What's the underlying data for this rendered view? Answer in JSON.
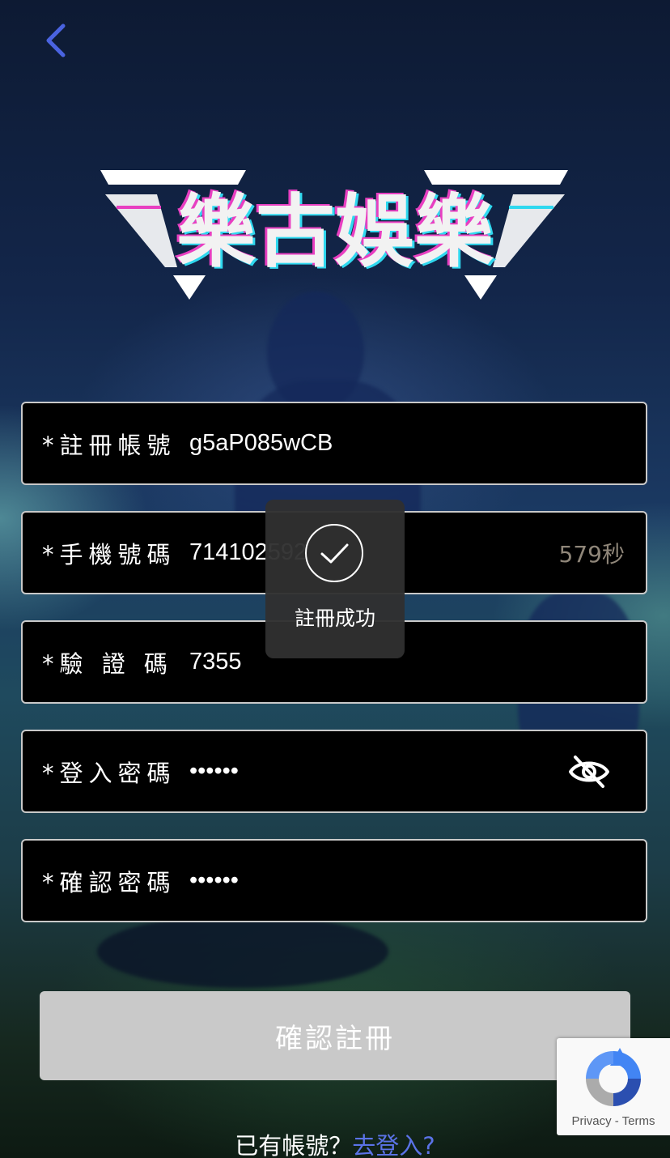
{
  "header": {
    "back_icon": "chevron-left-icon",
    "logo_text": "樂古娛樂"
  },
  "form": {
    "fields": [
      {
        "label": "*註冊帳號",
        "value": "g5aP085wCB"
      },
      {
        "label": "*手機號碼",
        "value": "714102592",
        "countdown": "579秒"
      },
      {
        "label": "*驗 證 碼",
        "value": "7355"
      },
      {
        "label": "*登入密碼",
        "value": "••••••",
        "toggle_icon": "eye-off-icon"
      },
      {
        "label": "*確認密碼",
        "value": "••••••"
      }
    ],
    "submit_label": "確認註冊"
  },
  "toast": {
    "icon": "check-circle-icon",
    "message": "註冊成功"
  },
  "footer": {
    "prompt": "已有帳號？",
    "login_link": "去登入?"
  },
  "recaptcha": {
    "privacy": "Privacy",
    "separator": " - ",
    "terms": "Terms"
  },
  "colors": {
    "accent_link": "#5b73e8",
    "back_icon": "#4a63e0",
    "button_disabled": "#c9c9c9",
    "countdown": "#8f8679"
  }
}
